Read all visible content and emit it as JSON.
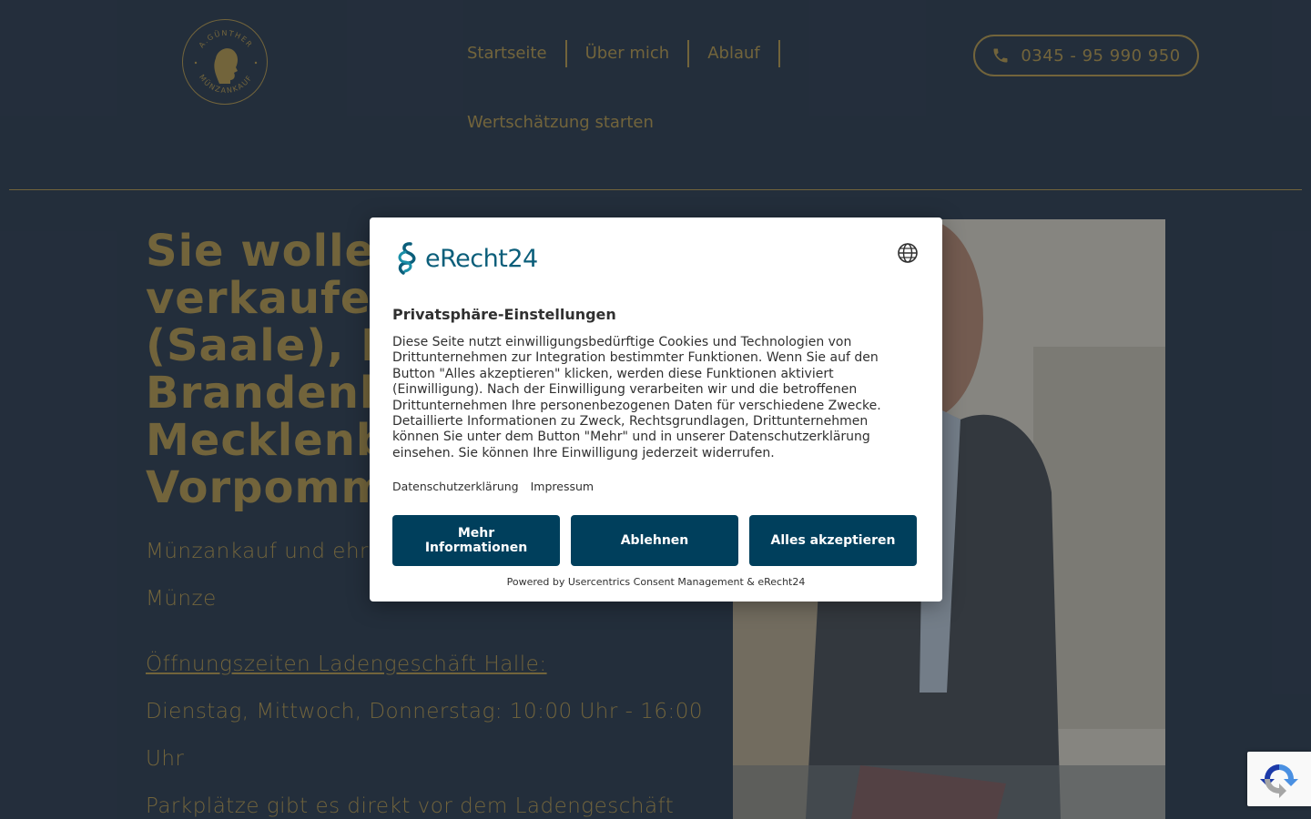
{
  "header": {
    "logo_top_text": "A.GÜNTHER",
    "logo_bottom_text": "MÜNZANKAUF",
    "nav": [
      {
        "label": "Startseite"
      },
      {
        "label": "Über mich"
      },
      {
        "label": "Ablauf"
      }
    ],
    "nav_second": "Wertschätzung starten",
    "phone": "0345 - 95 990 950"
  },
  "hero": {
    "title_lines": [
      "Sie wolle",
      "verkaufen",
      "(Saale), B",
      "Brandenb",
      "Mecklenb",
      "Vorpomm"
    ],
    "subtitle_line1": "Münzankauf und ehr",
    "subtitle_line2": "Münze",
    "hours_heading": "Öffnungszeiten Ladengeschäft Halle:",
    "hours_line1": "Dienstag, Mittwoch, Donnerstag: 10:00 Uhr - 16:00",
    "hours_line2": "Uhr",
    "parking": "Parkplätze gibt es direkt vor dem Ladengeschäft"
  },
  "consent": {
    "brand": "eRecht24",
    "title": "Privatsphäre-Einstellungen",
    "description": "Diese Seite nutzt einwilligungsbedürftige Cookies und Technologien von Drittunternehmen zur Integration bestimmter Funktionen. Wenn Sie auf den Button \"Alles akzeptieren\" klicken, werden diese Funktionen aktiviert (Einwilligung). Nach der Einwilligung verarbeiten wir und die betroffenen Drittunternehmen Ihre personenbezogenen Daten für verschiedene Zwecke. Detaillierte Informationen zu Zweck, Rechtsgrundlagen, Drittunternehmen können Sie unter dem Button \"Mehr\" und in unserer Datenschutzerklärung einsehen. Sie können Ihre Einwilligung jederzeit widerrufen.",
    "link_privacy": "Datenschutzerklärung",
    "link_imprint": "Impressum",
    "btn_more_line1": "Mehr",
    "btn_more_line2": "Informationen",
    "btn_decline": "Ablehnen",
    "btn_accept": "Alles akzeptieren",
    "footer": "Powered by Usercentrics Consent Management & eRecht24"
  },
  "colors": {
    "background": "#2f3d4f",
    "gold": "#b79a4f",
    "button": "#003f5c",
    "brand_teal": "#0b5e7a"
  }
}
